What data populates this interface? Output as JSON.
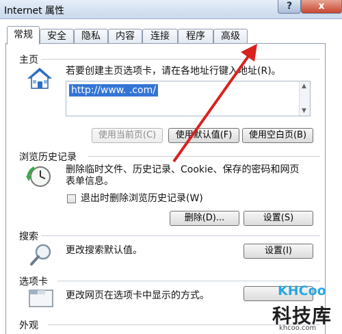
{
  "window": {
    "title": "Internet 属性",
    "help_label": "?",
    "close_label": "x"
  },
  "tabs": [
    {
      "label": "常规",
      "active": true
    },
    {
      "label": "安全"
    },
    {
      "label": "隐私"
    },
    {
      "label": "内容"
    },
    {
      "label": "连接"
    },
    {
      "label": "程序"
    },
    {
      "label": "高级"
    }
  ],
  "home": {
    "group_title": "主页",
    "description": "若要创建主页选项卡，请在各地址行键入地址(R)。",
    "url": "http://www.        .com/",
    "buttons": {
      "use_current": "使用当前页(C)",
      "use_default": "使用默认值(F)",
      "use_blank": "使用空白页(B)"
    }
  },
  "history": {
    "group_title": "浏览历史记录",
    "description": "删除临时文件、历史记录、Cookie、保存的密码和网页表单信息。",
    "checkbox_label": "退出时删除浏览历史记录(W)",
    "delete_label": "删除(D)...",
    "settings_label": "设置(S)"
  },
  "search": {
    "group_title": "搜索",
    "description": "更改搜索默认值。",
    "settings_label": "设置(I)"
  },
  "tabs_group": {
    "group_title": "选项卡",
    "description": "更改网页在选项卡中显示的方式。"
  },
  "appearance": {
    "group_title": "外观"
  },
  "watermark": {
    "logo": "KHCoo",
    "cn": "科技库",
    "url": "khcoo.com"
  },
  "colors": {
    "selection": "#3375d6",
    "arrow": "#d9211e",
    "watermark_accent": "#2aa7e0"
  }
}
